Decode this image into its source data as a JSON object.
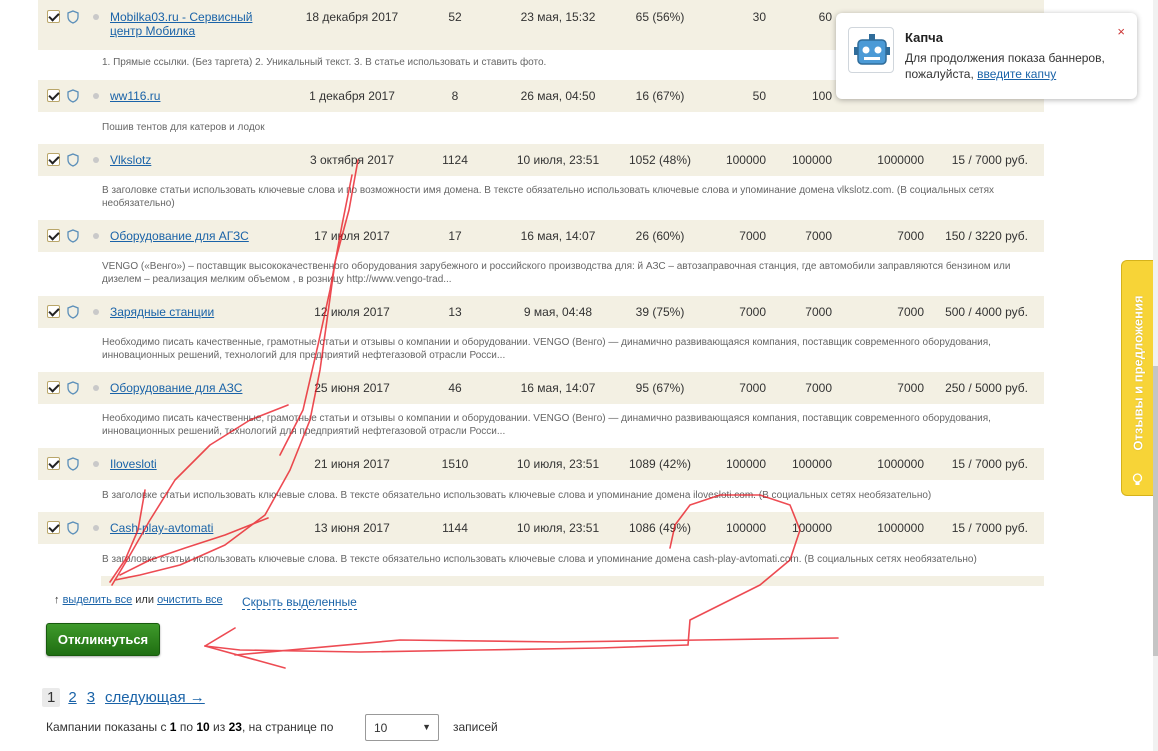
{
  "rows": [
    {
      "name": "Mobilka03.ru - Сервисный центр Мобилка",
      "date": "18 декабря 2017",
      "count": "52",
      "last": "23 мая, 15:32",
      "pct": "65 (56%)",
      "a": "30",
      "b": "60",
      "c": "",
      "d": "",
      "desc": "1. Прямые ссылки. (Без таргета) 2. Уникальный текст. 3. В статье использовать и ставить фото."
    },
    {
      "name": "ww116.ru",
      "date": "1 декабря 2017",
      "count": "8",
      "last": "26 мая, 04:50",
      "pct": "16 (67%)",
      "a": "50",
      "b": "100",
      "c": "",
      "d": "",
      "desc": "Пошив тентов для катеров и лодок"
    },
    {
      "name": "Vlkslotz",
      "date": "3 октября 2017",
      "count": "1124",
      "last": "10 июля, 23:51",
      "pct": "1052 (48%)",
      "a": "100000",
      "b": "100000",
      "c": "1000000",
      "d": "15 / 7000 руб.",
      "desc": "В заголовке статьи использовать ключевые слова и по возможности имя домена. В тексте обязательно использовать ключевые слова и упоминание домена vlkslotz.com. (В социальных сетях необязательно)"
    },
    {
      "name": "Оборудование для АГЗС",
      "date": "17 июля 2017",
      "count": "17",
      "last": "16 мая, 14:07",
      "pct": "26 (60%)",
      "a": "7000",
      "b": "7000",
      "c": "7000",
      "d": "150 / 3220 руб.",
      "desc": "VENGO («Венго») – поставщик высококачественного оборудования зарубежного и российского производства для: й АЗС – автозаправочная станция, где автомобили заправляются бензином или дизелем – реализация мелким объемом , в розницу http://www.vengo-trad..."
    },
    {
      "name": "Зарядные станции",
      "date": "12 июля 2017",
      "count": "13",
      "last": "9 мая, 04:48",
      "pct": "39 (75%)",
      "a": "7000",
      "b": "7000",
      "c": "7000",
      "d": "500 / 4000 руб.",
      "desc": "Необходимо писать качественные, грамотные статьи и отзывы о компании и оборудовании. VENGO (Венго) — динамично развивающаяся компания, поставщик современного оборудования, инновационных решений, технологий для предприятий нефтегазовой отрасли Росси..."
    },
    {
      "name": "Оборудование для АЗС",
      "date": "25 июня 2017",
      "count": "46",
      "last": "16 мая, 14:07",
      "pct": "95 (67%)",
      "a": "7000",
      "b": "7000",
      "c": "7000",
      "d": "250 / 5000 руб.",
      "desc": "Необходимо писать качественные, грамотные статьи и отзывы о компании и оборудовании. VENGO (Венго) — динамично развивающаяся компания, поставщик современного оборудования, инновационных решений, технологий для предприятий нефтегазовой отрасли Росси..."
    },
    {
      "name": "Iloveslotі",
      "date": "21 июня 2017",
      "count": "1510",
      "last": "10 июля, 23:51",
      "pct": "1089 (42%)",
      "a": "100000",
      "b": "100000",
      "c": "1000000",
      "d": "15 / 7000 руб.",
      "desc": "В заголовке статьи использовать ключевые слова. В тексте обязательно использовать ключевые слова и упоминание домена iloveslotі.com. (В социальных сетях необязательно)"
    },
    {
      "name": "Cash-play-avtomati",
      "date": "13 июня 2017",
      "count": "1144",
      "last": "10 июля, 23:51",
      "pct": "1086 (49%)",
      "a": "100000",
      "b": "100000",
      "c": "1000000",
      "d": "15 / 7000 руб.",
      "desc": "В заголовке статьи использовать ключевые слова. В тексте обязательно использовать ключевые слова и упоминание домена cash-play-avtomati.com. (В социальных сетях необязательно)"
    }
  ],
  "selection": {
    "arrow": "↑",
    "select_all": "выделить все",
    "or": "или",
    "clear_all": "очистить все",
    "hide_selected": "Скрыть выделенные"
  },
  "respond_button": "Откликнуться",
  "pagination": {
    "current": "1",
    "p2": "2",
    "p3": "3",
    "next": "следующая →"
  },
  "summary": {
    "prefix": "Кампании показаны с",
    "from": "1",
    "to_word": "по",
    "to": "10",
    "of_word": "из",
    "total": "23",
    "per_page_label": ", на странице по",
    "per_page": "10",
    "records": "записей"
  },
  "captcha": {
    "title": "Капча",
    "text_before": "Для продолжения показа баннеров, пожалуйста,",
    "link": "введите капчу",
    "close": "×"
  },
  "feedback_tab": {
    "label": "Отзывы и предложения"
  },
  "colors": {
    "row_bg": "#f3f0e3",
    "button_green": "#2c8a1e",
    "link": "#1a63a8",
    "feedback": "#f7d437",
    "scribble": "#e8101a"
  }
}
